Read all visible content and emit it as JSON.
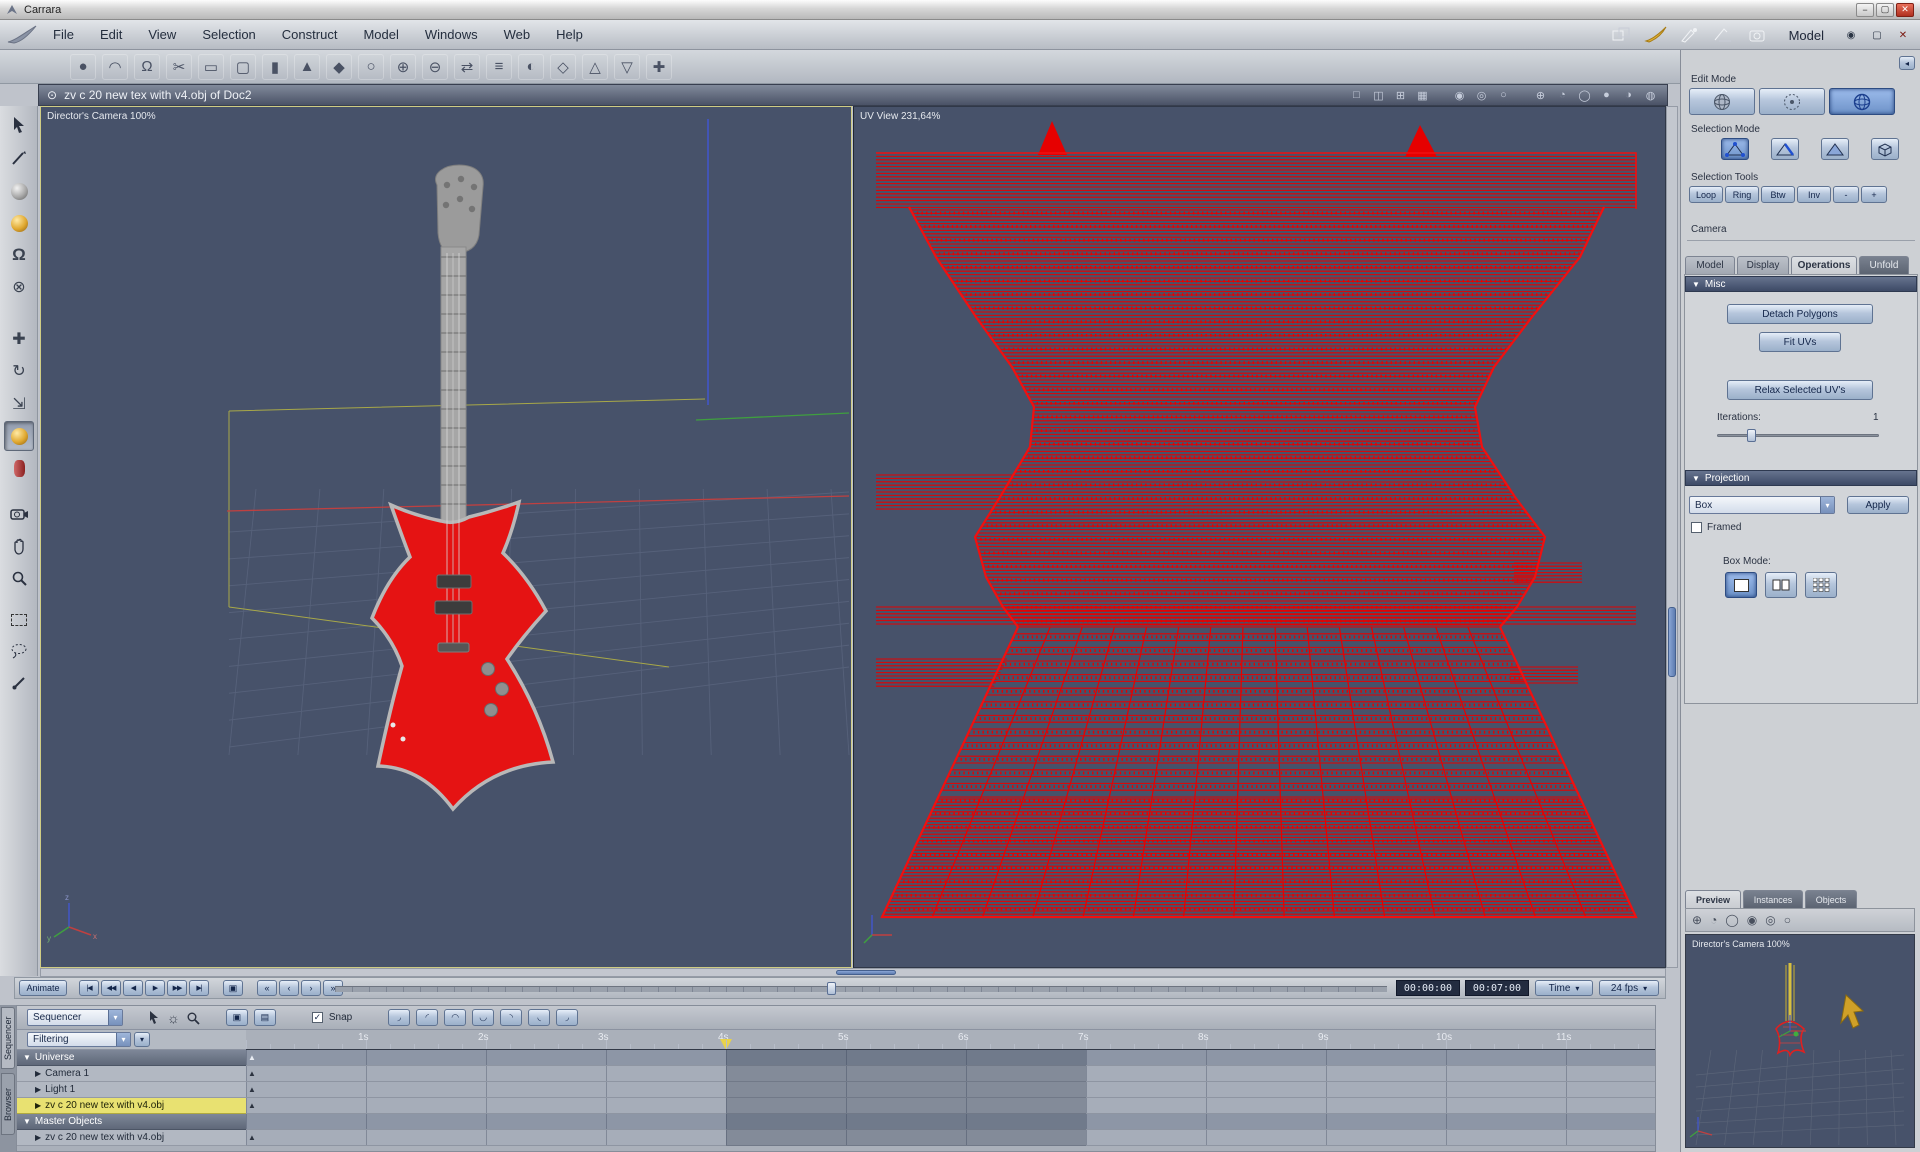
{
  "colors": {
    "viewport_bg": "#47526a",
    "mesh_red": "#e60000",
    "accent_blue": "#6d8fc4",
    "selection_yellow": "#e8e171"
  },
  "titlebar": {
    "title": "Carrara"
  },
  "menubar": {
    "items": [
      "File",
      "Edit",
      "View",
      "Selection",
      "Construct",
      "Model",
      "Windows",
      "Web",
      "Help"
    ],
    "room_label": "Model"
  },
  "docbar": {
    "title": "zv c 20 new tex with v4.obj of Doc2"
  },
  "viewports": {
    "left_label": "Director's Camera 100%",
    "right_label": "UV View 231,64%"
  },
  "panel": {
    "edit_mode_label": "Edit Mode",
    "selection_mode_label": "Selection Mode",
    "selection_tools_label": "Selection Tools",
    "selection_tools": [
      "Loop",
      "Ring",
      "Btw",
      "Inv",
      "-",
      "+"
    ],
    "camera_label": "Camera",
    "tabs": [
      "Model",
      "Display",
      "Operations",
      "Unfold"
    ],
    "misc_label": "Misc",
    "detach_label": "Detach Polygons",
    "fit_label": "Fit UVs",
    "relax_label": "Relax Selected UV's",
    "iterations_label": "Iterations:",
    "iterations_value": "1",
    "projection_label": "Projection",
    "projection_value": "Box",
    "apply_label": "Apply",
    "framed_label": "Framed",
    "box_mode_label": "Box Mode:",
    "bottom_tabs": [
      "Preview",
      "Instances",
      "Objects"
    ],
    "preview_camera": "Director's Camera 100%"
  },
  "animbar": {
    "animate_label": "Animate",
    "current_time": "00:00:00",
    "end_time": "00:07:00",
    "time_mode": "Time",
    "fps": "24 fps"
  },
  "sequencer": {
    "selector_label": "Sequencer",
    "filtering_label": "Filtering",
    "snap_label": "Snap",
    "side_tabs": [
      "Sequencer",
      "Browser"
    ],
    "ruler": [
      "1s",
      "2s",
      "3s",
      "4s",
      "5s",
      "6s",
      "7s",
      "8s",
      "9s",
      "10s",
      "11s"
    ],
    "rows": [
      {
        "label": "Universe",
        "kind": "header"
      },
      {
        "label": "Camera 1",
        "kind": "item"
      },
      {
        "label": "Light 1",
        "kind": "item"
      },
      {
        "label": "zv c 20 new tex with v4.obj",
        "kind": "item_selected"
      },
      {
        "label": "Master Objects",
        "kind": "header"
      },
      {
        "label": "zv c 20 new tex with v4.obj",
        "kind": "item"
      }
    ]
  },
  "icons": {
    "chevron_down": "▾",
    "disclosure_open": "▼",
    "disclosure_closed": "▶",
    "check": "✓",
    "doc_marker": "⊙",
    "doc_target": "◉",
    "window_min": "−",
    "window_max": "▢",
    "window_close": "✕",
    "transport": [
      "|◀",
      "◀◀",
      "◀",
      "▶",
      "▶▶",
      "▶|"
    ],
    "frame_button": "▣",
    "loop_group": [
      "«",
      "‹",
      "›",
      "»"
    ],
    "tangent": [
      "◞",
      "◜",
      "◠",
      "◡",
      "◝",
      "◟",
      "◞"
    ],
    "layout": [
      "□",
      "◫",
      "⊞",
      "▦"
    ],
    "shading": [
      "◉",
      "◎",
      "○"
    ],
    "view_circles": [
      "⊕",
      "◔",
      "◯",
      "●",
      "◑",
      "◍"
    ],
    "toolbar": [
      "●",
      "◠",
      "Ω",
      "✂",
      "▭",
      "▢",
      "▮",
      "▲",
      "◆",
      "○",
      "⊕",
      "⊖",
      "⇄",
      "≡",
      "◐",
      "◇",
      "△",
      "▽",
      "✚"
    ],
    "grp_icons": [
      "▣",
      "▤"
    ],
    "sun": "☼"
  }
}
